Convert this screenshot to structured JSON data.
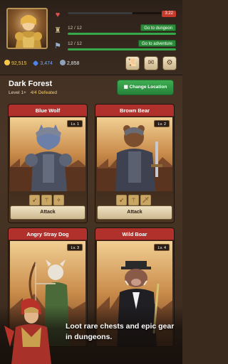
{
  "stats": {
    "timer": "3:22",
    "dungeon": {
      "text": "12 / 12",
      "button": "Go to dungeon",
      "progress": 1.0
    },
    "adventure": {
      "text": "12 / 12",
      "button": "Go to adventure",
      "progress": 1.0
    }
  },
  "currencies": {
    "gold": "92,515",
    "gems": "3,474",
    "other": "2,858"
  },
  "header_buttons": [
    "scroll-icon",
    "mail-icon",
    "gear-icon"
  ],
  "location": {
    "name": "Dark Forest",
    "level": "Level 1+",
    "defeated": "4/4 Defeated",
    "change_label": "Change Location"
  },
  "cards": [
    {
      "name": "Blue Wolf",
      "level": "Lv. 1",
      "attack": "Attack"
    },
    {
      "name": "Brown Bear",
      "level": "Lv. 2",
      "attack": "Attack"
    },
    {
      "name": "Angry Stray Dog",
      "level": "Lv. 3"
    },
    {
      "name": "Wild Boar",
      "level": "Lv. 4"
    }
  ],
  "promo": "Loot rare chests and epic gear in dungeons.",
  "colors": {
    "accent_green": "#2e8b3a",
    "title_red": "#b0312b",
    "timer_red": "#c83a2c",
    "gold": "#f5c84b"
  }
}
